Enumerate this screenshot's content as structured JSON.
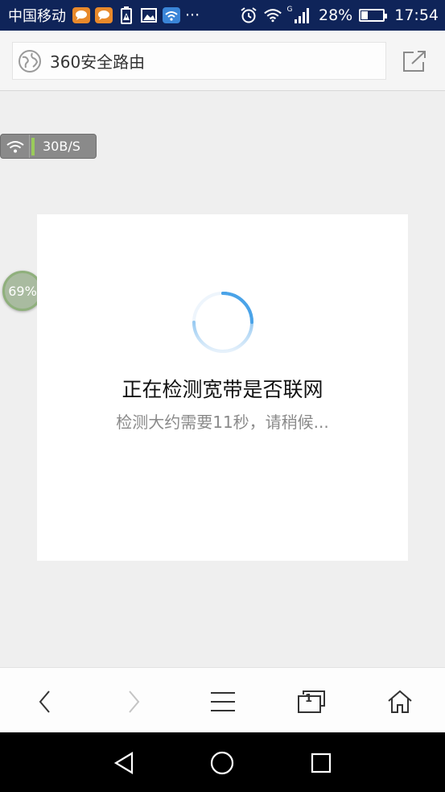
{
  "status_bar": {
    "carrier": "中国移动",
    "more": "···",
    "network_type": "G",
    "battery_level": "28%",
    "time": "17:54",
    "icons": [
      "message-icon",
      "message-icon",
      "battery-alert-icon",
      "image-icon",
      "wifi-app-icon",
      "alarm-icon",
      "wifi-icon",
      "signal-icon",
      "battery-icon"
    ]
  },
  "address_bar": {
    "title": "360安全路由",
    "icon": "globe-icon",
    "action_icon": "share-icon"
  },
  "speed_widget": {
    "speed": "30B/S",
    "icon": "wifi-icon"
  },
  "percent_widget": {
    "value": "69%"
  },
  "card": {
    "title": "正在检测宽带是否联网",
    "subtitle": "检测大约需要11秒，请稍候..."
  },
  "toolbar": {
    "tabs_count": "1",
    "buttons": [
      "back-icon",
      "forward-icon",
      "menu-icon",
      "tabs-icon",
      "home-icon"
    ]
  },
  "nav_bar": {
    "buttons": [
      "back-triangle-icon",
      "home-circle-icon",
      "recents-square-icon"
    ]
  },
  "colors": {
    "status_bar": "#0f2459",
    "spinner": "#5aa9e6",
    "speed_bar": "#9acb5a"
  }
}
